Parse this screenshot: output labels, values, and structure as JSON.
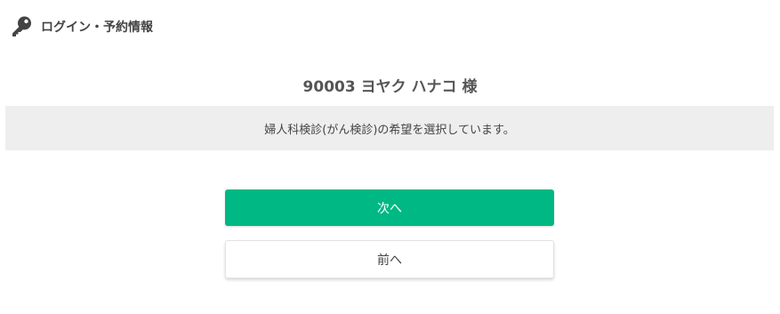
{
  "header": {
    "icon": "key-icon",
    "title": "ログイン・予約情報"
  },
  "user": {
    "display_name": "90003 ヨヤク ハナコ 様"
  },
  "notice": {
    "text": "婦人科検診(がん検診)の希望を選択しています。"
  },
  "buttons": {
    "next_label": "次へ",
    "prev_label": "前へ"
  },
  "colors": {
    "accent": "#00b884",
    "band": "#eeeeee",
    "text": "#555555"
  }
}
